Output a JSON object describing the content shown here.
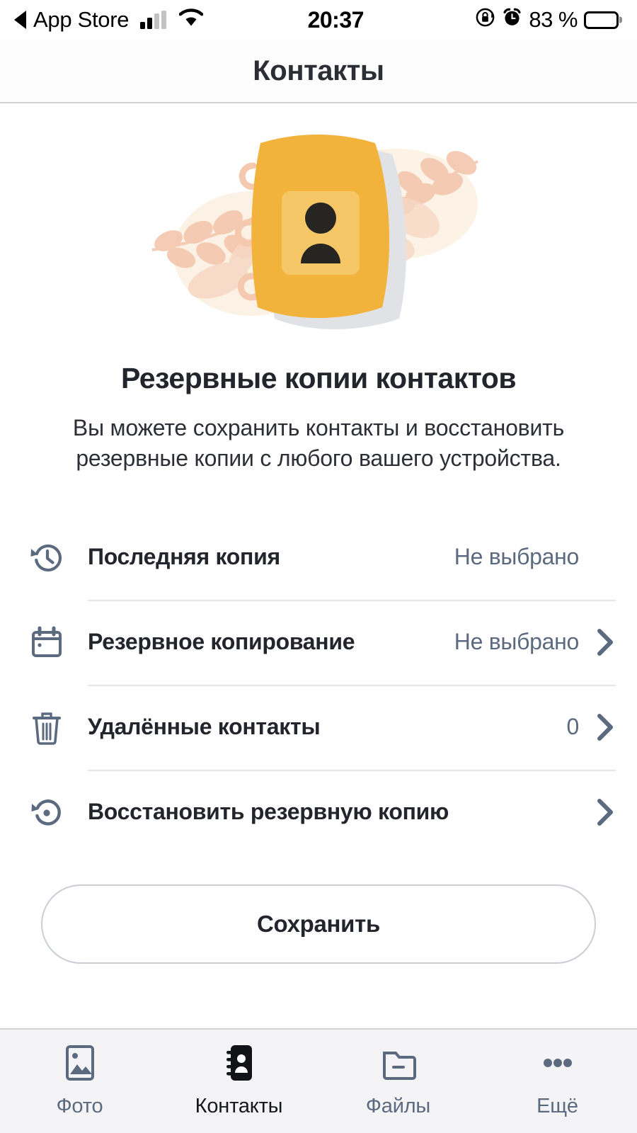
{
  "status_bar": {
    "back_label": "App Store",
    "back_icon": "back-triangle-icon",
    "signal_icon": "cellular-signal-icon",
    "wifi_icon": "wifi-icon",
    "time": "20:37",
    "rotation_lock_icon": "rotation-lock-icon",
    "alarm_icon": "alarm-clock-icon",
    "battery_percent": "83 %",
    "battery_icon": "battery-icon"
  },
  "header": {
    "title": "Контакты"
  },
  "hero": {
    "illustration": "address-book-illustration",
    "title": "Резервные копии контактов",
    "description": "Вы можете сохранить контакты и восстановить резервные копии с любого вашего устройства."
  },
  "list": {
    "rows": [
      {
        "icon": "history-clock-icon",
        "label": "Последняя копия",
        "value": "Не выбрано",
        "chevron": false
      },
      {
        "icon": "calendar-icon",
        "label": "Резервное копирование",
        "value": "Не выбрано",
        "chevron": true
      },
      {
        "icon": "trash-icon",
        "label": "Удалённые контакты",
        "value": "0",
        "chevron": true
      },
      {
        "icon": "restore-icon",
        "label": "Восстановить резервную копию",
        "value": "",
        "chevron": true
      }
    ]
  },
  "actions": {
    "save_label": "Сохранить"
  },
  "tab_bar": {
    "tabs": [
      {
        "icon": "photo-icon",
        "label": "Фото",
        "active": false
      },
      {
        "icon": "contacts-icon",
        "label": "Контакты",
        "active": true
      },
      {
        "icon": "files-icon",
        "label": "Файлы",
        "active": false
      },
      {
        "icon": "more-icon",
        "label": "Ещё",
        "active": false
      }
    ]
  },
  "colors": {
    "accent_yellow": "#f2b33d",
    "accent_leaf": "#f4c9b0",
    "slate": "#5c6a80",
    "text_dark": "#22252b",
    "divider": "#e6e7ea",
    "tabbar_bg": "#f4f4f6"
  }
}
